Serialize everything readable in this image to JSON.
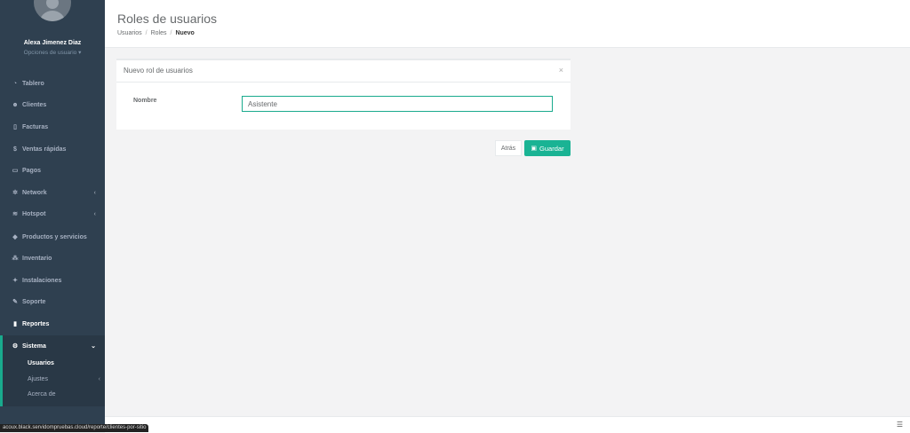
{
  "header": {
    "title": "Roles de usuarios",
    "breadcrumb": [
      "Usuarios",
      "Roles",
      "Nuevo"
    ]
  },
  "sidebar": {
    "user_name": "Alexa Jimenez Diaz",
    "user_options": "Opciones de usuario",
    "items": [
      {
        "label": "Tablero",
        "icon": "dashboard-icon"
      },
      {
        "label": "Clientes",
        "icon": "users-icon"
      },
      {
        "label": "Facturas",
        "icon": "file-icon"
      },
      {
        "label": "Ventas rápidas",
        "icon": "dollar-icon"
      },
      {
        "label": "Pagos",
        "icon": "money-icon"
      },
      {
        "label": "Network",
        "icon": "network-icon"
      },
      {
        "label": "Hotspot",
        "icon": "wifi-icon"
      },
      {
        "label": "Productos y servicios",
        "icon": "tag-icon"
      },
      {
        "label": "Inventario",
        "icon": "cubes-icon"
      },
      {
        "label": "Instalaciones",
        "icon": "tools-icon"
      },
      {
        "label": "Soporte",
        "icon": "wrench-icon"
      },
      {
        "label": "Reportes",
        "icon": "book-icon"
      },
      {
        "label": "Sistema",
        "icon": "cogs-icon"
      }
    ],
    "sistema_subitems": [
      "Usuarios",
      "Ajustes",
      "Acerca de"
    ]
  },
  "panel": {
    "title": "Nuevo rol de usuarios",
    "field_label": "Nombre",
    "field_value": "Asistente"
  },
  "actions": {
    "back_label": "Atrás",
    "save_label": "Guardar"
  },
  "status_bar": {
    "url": "acoux.black.servidompruebas.cloud/reporte/clientes-por-sitio"
  },
  "colors": {
    "sidebar_bg": "#2f4050",
    "accent": "#1ab394"
  }
}
